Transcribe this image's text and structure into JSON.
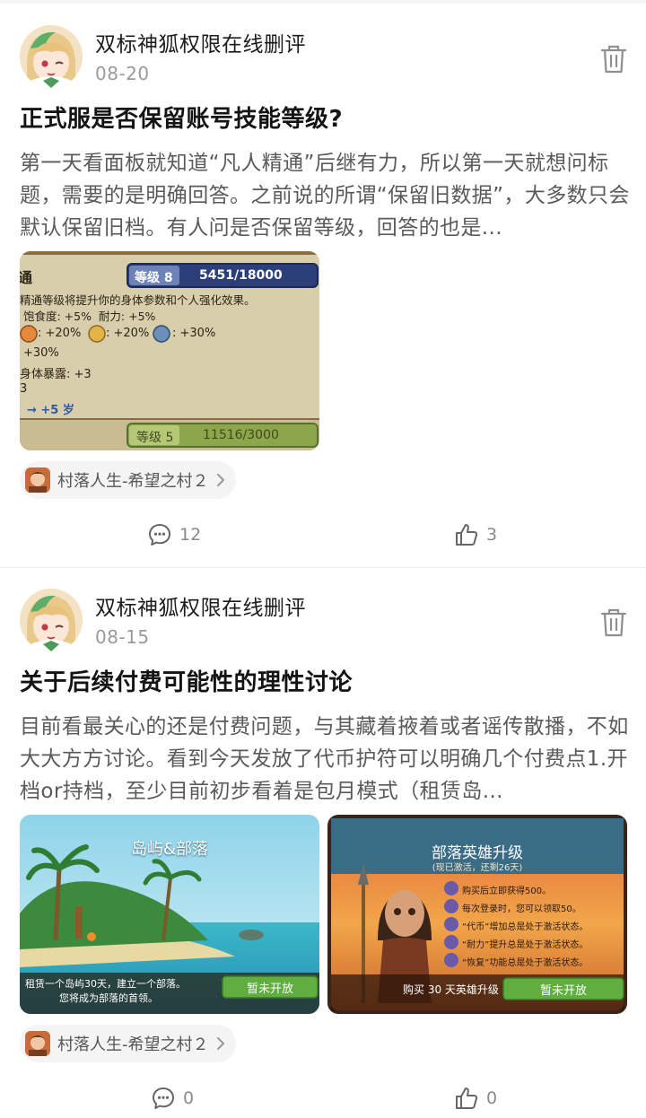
{
  "posts": [
    {
      "author": "双标神狐权限在线删评",
      "date": "08-20",
      "title": "正式服是否保留账号技能等级?",
      "excerpt": "第一天看面板就知道“凡人精通”后继有力，所以第一天就想问标题，需要的是明确回答。之前说的所谓“保留旧数据”，大多数只会默认保留旧档。有人问是否保留等级，回答的也是...",
      "game": "村落人生-希望之村２",
      "comments": "12",
      "likes": "3",
      "shot": {
        "heading": "通",
        "level_label": "等级 8",
        "level_progress": "5451/18000",
        "level_progress_fraction": 0.3,
        "line1": "精通等级将提升你的身体参数和个人强化效果。",
        "line2": "饱食度: +5%  耐力: +5%",
        "line3a": ": +20%",
        "line3b": ": +20%",
        "line3c": ": +30%",
        "line4": "+30%",
        "line5": "身体暴露: +3",
        "line6": "3",
        "line7": "→ +5 岁",
        "bottom_label": "等级 5",
        "bottom_progress": "11516/3000"
      }
    },
    {
      "author": "双标神狐权限在线删评",
      "date": "08-15",
      "title": "关于后续付费可能性的理性讨论",
      "excerpt": "目前看最关心的还是付费问题，与其藏着掖着或者谣传散播，不如大大方方讨论。看到今天发放了代币护符可以明确几个付费点1.开档or持档，至少目前初步看着是包月模式（租赁岛...",
      "game": "村落人生-希望之村２",
      "comments": "0",
      "likes": "0",
      "shot_left": {
        "title": "岛屿&部落",
        "caption1": "租赁一个岛屿30天，建立一个部落。",
        "caption2": "您将成为部落的首领。",
        "button": "暂未开放"
      },
      "shot_right": {
        "title": "部落英雄升级",
        "subtitle": "(现已激活，还剩26天)",
        "items": [
          "购买后立即获得500。",
          "每次登录时，您可以领取50。",
          "“代币”增加总是处于激活状态。",
          "“耐力”提升总是处于激活状态。",
          "“恢复”功能总是处于激活状态。"
        ],
        "buy_text": "购买 30 天英雄升级",
        "button": "暂未开放"
      }
    }
  ]
}
